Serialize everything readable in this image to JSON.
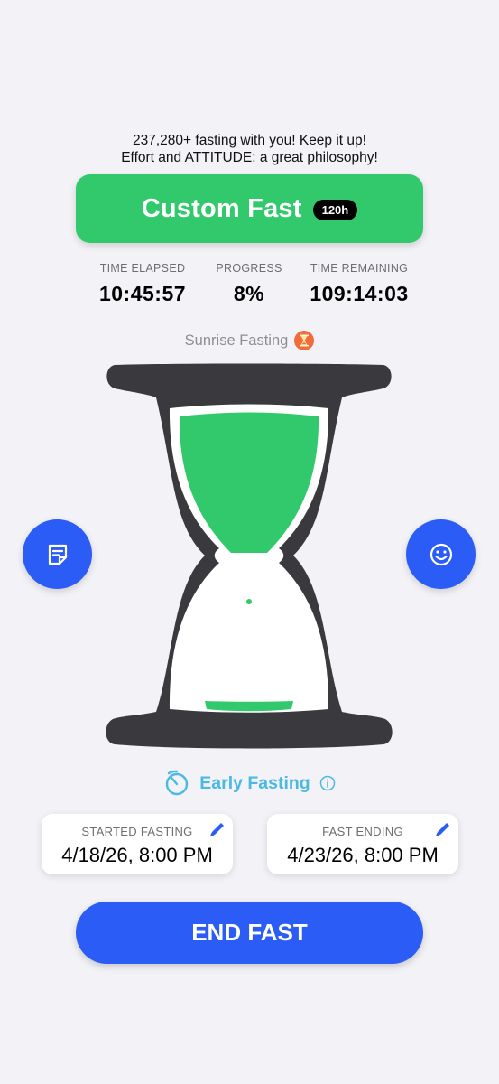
{
  "motto": {
    "line1": "237,280+ fasting with you! Keep it up!",
    "line2": "Effort and ATTITUDE: a great philosophy!"
  },
  "fast": {
    "name": "Custom Fast",
    "duration_badge": "120h"
  },
  "stats": {
    "elapsed": {
      "label": "TIME ELAPSED",
      "value": "10:45:57"
    },
    "progress": {
      "label": "PROGRESS",
      "value": "8%"
    },
    "remaining": {
      "label": "TIME REMAINING",
      "value": "109:14:03"
    }
  },
  "stage": {
    "label": "Sunrise Fasting",
    "icon": "hourglass-emoji-icon"
  },
  "hourglass": {
    "progress_fraction": 0.08,
    "frame_color": "#3a393e",
    "sand_color": "#31c96b"
  },
  "side_buttons": {
    "left_icon": "notes-icon",
    "right_icon": "smiley-icon"
  },
  "phase": {
    "label": "Early Fasting",
    "icon": "timer-icon",
    "info_icon": "info-icon"
  },
  "started": {
    "label": "STARTED FASTING",
    "value": "4/18/26, 8:00 PM",
    "edit_icon": "pencil-icon"
  },
  "ending": {
    "label": "FAST ENDING",
    "value": "4/23/26, 8:00 PM",
    "edit_icon": "pencil-icon"
  },
  "end_button": {
    "label": "END FAST"
  },
  "colors": {
    "accent_blue": "#2b5cf6",
    "accent_green": "#31c96b",
    "phase_blue": "#4bb9e3",
    "background": "#f2f2f7"
  }
}
